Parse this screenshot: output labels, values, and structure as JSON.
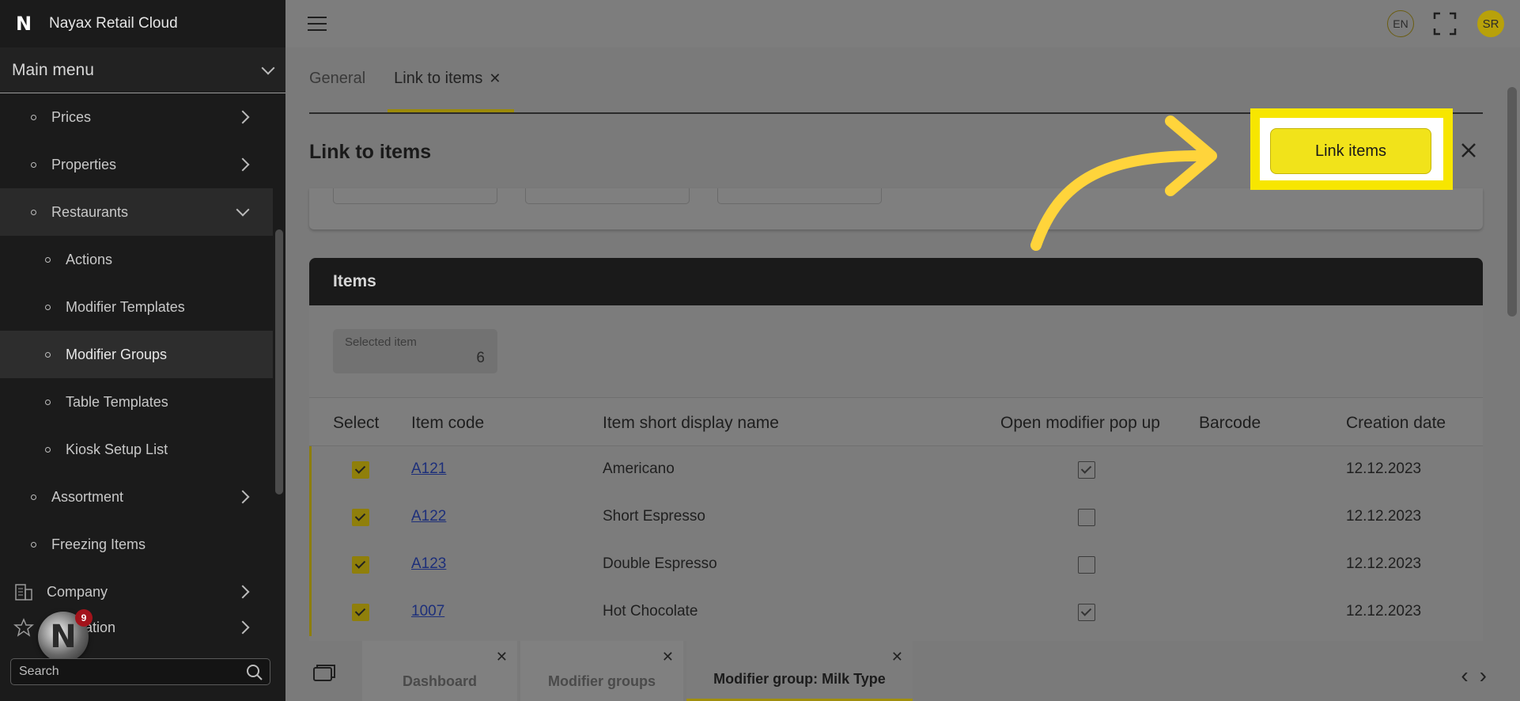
{
  "app": {
    "title": "Nayax Retail Cloud",
    "logo_letter": "N"
  },
  "sidebar": {
    "main_menu": "Main menu",
    "items": [
      {
        "label": "Prices",
        "level": 1
      },
      {
        "label": "Properties",
        "level": 1
      },
      {
        "label": "Restaurants",
        "level": 1,
        "expanded": true
      },
      {
        "label": "Actions",
        "level": 2
      },
      {
        "label": "Modifier Templates",
        "level": 2
      },
      {
        "label": "Modifier Groups",
        "level": 2,
        "selected": true
      },
      {
        "label": "Table Templates",
        "level": 2
      },
      {
        "label": "Kiosk Setup List",
        "level": 2
      },
      {
        "label": "Assortment",
        "level": 1
      },
      {
        "label": "Freezing Items",
        "level": 1
      },
      {
        "label": "Company",
        "level": 1,
        "icon": "building-icon"
      },
      {
        "label": "ation",
        "level": 1,
        "icon": "star-icon"
      }
    ],
    "search_placeholder": "Search",
    "notification_count": "9"
  },
  "topbar": {
    "language": "EN",
    "user_initials": "SR"
  },
  "tabs": [
    {
      "label": "General"
    },
    {
      "label": "Link to items",
      "active": true
    }
  ],
  "panel": {
    "title": "Link to items",
    "link_button": "Link items"
  },
  "items_section": {
    "title": "Items",
    "selected_label": "Selected item",
    "selected_value": "6",
    "columns": [
      "Select",
      "Item code",
      "Item short display name",
      "Open modifier pop up",
      "Barcode",
      "Creation date"
    ],
    "rows": [
      {
        "code": "A121",
        "name": "Americano",
        "open_popup": true,
        "barcode": "",
        "date": "12.12.2023"
      },
      {
        "code": "A122",
        "name": "Short Espresso",
        "open_popup": false,
        "barcode": "",
        "date": "12.12.2023"
      },
      {
        "code": "A123",
        "name": "Double Espresso",
        "open_popup": false,
        "barcode": "",
        "date": "12.12.2023"
      },
      {
        "code": "1007",
        "name": "Hot Chocolate",
        "open_popup": true,
        "barcode": "",
        "date": "12.12.2023"
      }
    ]
  },
  "bottom_tabs": [
    {
      "label": "Dashboard"
    },
    {
      "label": "Modifier groups"
    },
    {
      "label": "Modifier group: Milk Type",
      "active": true
    }
  ],
  "colors": {
    "accent": "#f1e31a",
    "highlight": "#f7e600",
    "arrow": "#ffd43b",
    "sidebar": "#1b1b1b"
  }
}
